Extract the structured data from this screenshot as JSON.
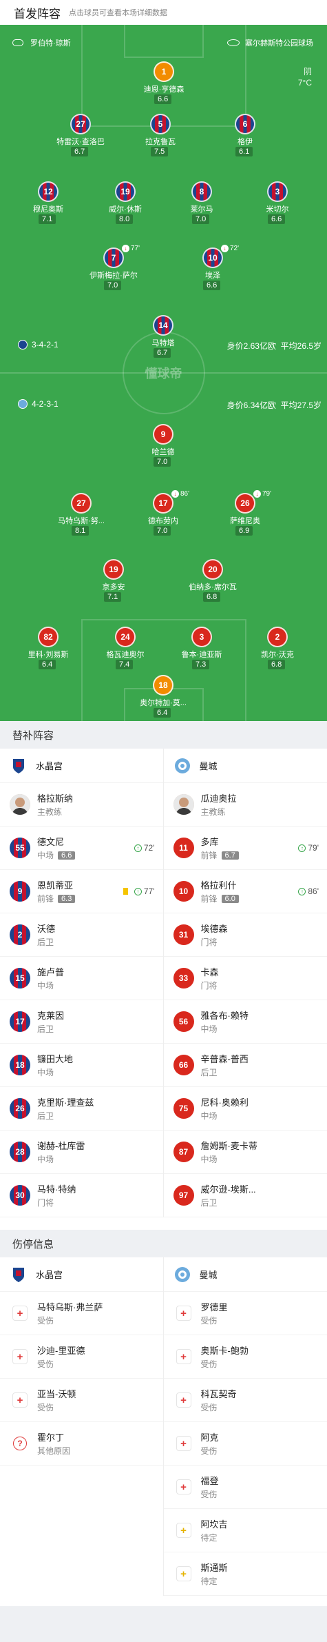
{
  "header": {
    "title": "首发阵容",
    "subtitle": "点击球员可查看本场详细数据"
  },
  "pitch": {
    "referee": "罗伯特·琼斯",
    "stadium": "塞尔赫斯特公园球场",
    "weather": "阴",
    "temperature": "7°C",
    "watermark": "懂球帝",
    "home": {
      "formation": "3-4-2-1",
      "value": "身价2.63亿欧",
      "age": "平均26.5岁"
    },
    "away": {
      "formation": "4-2-3-1",
      "value": "身价6.34亿欧",
      "age": "平均27.5岁"
    },
    "players": [
      {
        "num": "1",
        "name": "迪恩·亨德森",
        "rating": "6.6"
      },
      {
        "num": "27",
        "name": "特雷沃·查洛巴",
        "rating": "6.7"
      },
      {
        "num": "5",
        "name": "拉克鲁瓦",
        "rating": "7.5"
      },
      {
        "num": "6",
        "name": "格伊",
        "rating": "6.1"
      },
      {
        "num": "12",
        "name": "穆尼奥斯",
        "rating": "7.1"
      },
      {
        "num": "19",
        "name": "威尔·休斯",
        "rating": "8.0"
      },
      {
        "num": "8",
        "name": "莱尔马",
        "rating": "7.0"
      },
      {
        "num": "3",
        "name": "米切尔",
        "rating": "6.6"
      },
      {
        "num": "7",
        "name": "伊斯梅拉·萨尔",
        "rating": "7.0",
        "sub": "77'"
      },
      {
        "num": "10",
        "name": "埃泽",
        "rating": "6.6",
        "sub": "72'"
      },
      {
        "num": "14",
        "name": "马特塔",
        "rating": "6.7"
      },
      {
        "num": "9",
        "name": "哈兰德",
        "rating": "7.0"
      },
      {
        "num": "27",
        "name": "马特乌斯·努...",
        "rating": "8.1"
      },
      {
        "num": "17",
        "name": "德布劳内",
        "rating": "7.0",
        "sub": "86'"
      },
      {
        "num": "26",
        "name": "萨维尼奥",
        "rating": "6.9",
        "sub": "79'"
      },
      {
        "num": "19",
        "name": "京多安",
        "rating": "7.1"
      },
      {
        "num": "20",
        "name": "伯纳多·席尔瓦",
        "rating": "6.8"
      },
      {
        "num": "82",
        "name": "里科·刘易斯",
        "rating": "6.4"
      },
      {
        "num": "24",
        "name": "格瓦迪奥尔",
        "rating": "7.4"
      },
      {
        "num": "3",
        "name": "鲁本·迪亚斯",
        "rating": "7.3"
      },
      {
        "num": "2",
        "name": "凯尔·沃克",
        "rating": "6.8"
      },
      {
        "num": "18",
        "name": "奥尔特加·莫...",
        "rating": "6.4"
      }
    ]
  },
  "subs": {
    "title": "替补阵容",
    "home_team": "水晶宫",
    "away_team": "曼城",
    "coach_role": "主教练",
    "home": [
      {
        "name": "格拉斯纳",
        "pos": "主教练",
        "coach": true
      },
      {
        "num": "55",
        "name": "德文尼",
        "pos": "中场",
        "rating": "6.6",
        "in": "72'"
      },
      {
        "num": "9",
        "name": "恩凯蒂亚",
        "pos": "前锋",
        "rating": "6.3",
        "in": "77'",
        "yellow": true
      },
      {
        "num": "2",
        "name": "沃德",
        "pos": "后卫"
      },
      {
        "num": "15",
        "name": "施卢普",
        "pos": "中场"
      },
      {
        "num": "17",
        "name": "克莱因",
        "pos": "后卫"
      },
      {
        "num": "18",
        "name": "镰田大地",
        "pos": "中场"
      },
      {
        "num": "26",
        "name": "克里斯·理查兹",
        "pos": "后卫"
      },
      {
        "num": "28",
        "name": "谢赫-杜库雷",
        "pos": "中场"
      },
      {
        "num": "30",
        "name": "马特·特纳",
        "pos": "门将"
      }
    ],
    "away": [
      {
        "name": "瓜迪奥拉",
        "pos": "主教练",
        "coach": true
      },
      {
        "num": "11",
        "name": "多库",
        "pos": "前锋",
        "rating": "6.7",
        "in": "79'"
      },
      {
        "num": "10",
        "name": "格拉利什",
        "pos": "前锋",
        "rating": "6.0",
        "in": "86'"
      },
      {
        "num": "31",
        "name": "埃德森",
        "pos": "门将"
      },
      {
        "num": "33",
        "name": "卡森",
        "pos": "门将"
      },
      {
        "num": "56",
        "name": "雅各布·赖特",
        "pos": "中场"
      },
      {
        "num": "66",
        "name": "辛普森-普西",
        "pos": "后卫"
      },
      {
        "num": "75",
        "name": "尼科·奥赖利",
        "pos": "中场"
      },
      {
        "num": "87",
        "name": "詹姆斯·麦卡蒂",
        "pos": "中场"
      },
      {
        "num": "97",
        "name": "威尔逊-埃斯...",
        "pos": "后卫"
      }
    ]
  },
  "injuries": {
    "title": "伤停信息",
    "home": [
      {
        "name": "马特乌斯·弗兰萨",
        "reason": "受伤"
      },
      {
        "name": "沙迪-里亚德",
        "reason": "受伤"
      },
      {
        "name": "亚当-沃顿",
        "reason": "受伤"
      },
      {
        "name": "霍尔丁",
        "reason": "其他原因"
      }
    ],
    "away": [
      {
        "name": "罗德里",
        "reason": "受伤"
      },
      {
        "name": "奥斯卡-鲍勃",
        "reason": "受伤"
      },
      {
        "name": "科瓦契奇",
        "reason": "受伤"
      },
      {
        "name": "阿克",
        "reason": "受伤"
      },
      {
        "name": "福登",
        "reason": "受伤"
      },
      {
        "name": "阿坎吉",
        "reason": "待定"
      },
      {
        "name": "斯通斯",
        "reason": "待定"
      }
    ]
  }
}
